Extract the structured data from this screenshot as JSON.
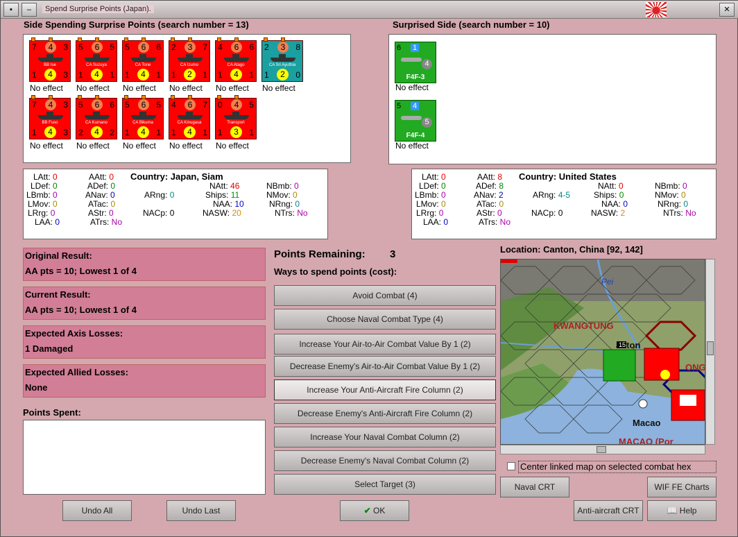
{
  "window": {
    "title": "Spend Surprise Points (Japan)."
  },
  "left": {
    "header": "Side Spending Surprise Points (search number = 13)"
  },
  "right": {
    "header": "Surprised Side (search number = 10)"
  },
  "attackers": [
    {
      "name": "BB Ise",
      "tl": "7",
      "top": "4",
      "tr": "3",
      "bl": "1",
      "bot": "4",
      "br": "3",
      "color": "#ff0000",
      "effect": "No effect"
    },
    {
      "name": "CA Suzuya",
      "tl": "5",
      "top": "6",
      "tr": "5",
      "bl": "1",
      "bot": "4",
      "br": "1",
      "color": "#ff0000",
      "effect": "No effect"
    },
    {
      "name": "CA Tone",
      "tl": "5",
      "top": "6",
      "tr": "6",
      "bl": "1",
      "bot": "4",
      "br": "1",
      "color": "#ff0000",
      "effect": "No effect"
    },
    {
      "name": "CA Izumo",
      "tl": "2",
      "top": "3",
      "tr": "7",
      "bl": "1",
      "bot": "2",
      "br": "1",
      "color": "#ff0000",
      "effect": "No effect"
    },
    {
      "name": "CA Atago",
      "tl": "4",
      "top": "6",
      "tr": "6",
      "bl": "1",
      "bot": "4",
      "br": "1",
      "color": "#ff0000",
      "effect": "No effect"
    },
    {
      "name": "CA Sri Ayuthia",
      "sub": "SIA",
      "tl": "2",
      "top": "3",
      "tr": "8",
      "bl": "1",
      "bot": "2",
      "br": "0",
      "color": "#1aa0a0",
      "effect": "No effect"
    },
    {
      "name": "BB Fuso",
      "tl": "7",
      "top": "4",
      "tr": "3",
      "bl": "1",
      "bot": "4",
      "br": "3",
      "color": "#ff0000",
      "effect": "No effect"
    },
    {
      "name": "CA Kumano",
      "tl": "5",
      "top": "6",
      "tr": "6",
      "bl": "2",
      "bot": "4",
      "br": "2",
      "color": "#ff0000",
      "effect": "No effect"
    },
    {
      "name": "CA Bikuma",
      "tl": "5",
      "top": "6",
      "tr": "5",
      "bl": "1",
      "bot": "4",
      "br": "1",
      "color": "#ff0000",
      "effect": "No effect"
    },
    {
      "name": "CA Kinugasa",
      "tl": "4",
      "top": "6",
      "tr": "7",
      "bl": "1",
      "bot": "4",
      "br": "1",
      "color": "#ff0000",
      "effect": "No effect"
    },
    {
      "name": "Transport",
      "tl": "0",
      "top": "4",
      "tr": "5",
      "bl": "1",
      "bot": "3",
      "br": "1",
      "color": "#ff0000",
      "effect": "No effect"
    }
  ],
  "defenders": [
    {
      "name": "F4F-3",
      "tag": "1",
      "val": "4",
      "tl": "6",
      "effect": "No effect"
    },
    {
      "name": "F4F-4",
      "tag": "4",
      "val": "5",
      "tl": "5",
      "effect": "No effect"
    }
  ],
  "stats_left": {
    "country_label": "Country:",
    "country": "Japan, Siam",
    "LAtt": "0",
    "LDef": "0",
    "LBmb": "0",
    "LMov": "0",
    "LRrg": "0",
    "LAA": "0",
    "AAtt": "0",
    "ADef": "0",
    "ANav": "0",
    "ATac": "0",
    "AStr": "0",
    "ATrs": "No",
    "ARng": "0",
    "NACp": "0",
    "NAtt": "46",
    "Ships": "11",
    "NAA": "10",
    "NASW": "20",
    "NBmb": "0",
    "NMov": "0",
    "NRng": "0",
    "NTrs": "No"
  },
  "stats_right": {
    "country_label": "Country:",
    "country": "United States",
    "LAtt": "0",
    "LDef": "0",
    "LBmb": "0",
    "LMov": "0",
    "LRrg": "0",
    "LAA": "0",
    "AAtt": "8",
    "ADef": "8",
    "ANav": "2",
    "ATac": "0",
    "AStr": "0",
    "ATrs": "No",
    "ARng": "4-5",
    "NACp": "0",
    "NAtt": "0",
    "Ships": "0",
    "NAA": "0",
    "NASW": "2",
    "NBmb": "0",
    "NMov": "0",
    "NRng": "0",
    "NTrs": "No"
  },
  "results": {
    "original_label": "Original Result:",
    "original": "AA pts = 10; Lowest 1 of 4",
    "current_label": "Current Result:",
    "current": "AA pts = 10; Lowest 1 of 4",
    "axis_label": "Expected Axis Losses:",
    "axis": "1 Damaged",
    "allied_label": "Expected Allied Losses:",
    "allied": "None",
    "spent_label": "Points Spent:"
  },
  "points": {
    "label": "Points Remaining:",
    "value": "3",
    "ways": "Ways to spend points (cost):"
  },
  "options": [
    "Avoid Combat (4)",
    "Choose Naval Combat Type (4)",
    "Increase Your Air-to-Air Combat Value By 1 (2)",
    "Decrease Enemy's Air-to-Air Combat Value By 1 (2)",
    "Increase Your Anti-Aircraft Fire Column (2)",
    "Decrease Enemy's Anti-Aircraft Fire Column (2)",
    "Increase Your Naval Combat Column (2)",
    "Decrease Enemy's Naval Combat Column (2)",
    "Select Target (3)"
  ],
  "location": {
    "label": "Location: Canton, China [92, 142]"
  },
  "map": {
    "pei": "Pei",
    "kwangtung": "KWANGTUNG",
    "canton": "anton",
    "macao": "Macao",
    "macao_port": "MACAO (Por",
    "onc": "ONG",
    "num15": "15"
  },
  "center_linked": "Center linked map on selected combat hex",
  "buttons": {
    "undo_all": "Undo All",
    "undo_last": "Undo Last",
    "ok": "OK",
    "naval_crt": "Naval CRT",
    "wif_fe": "WIF FE Charts",
    "aa_crt": "Anti-aircraft CRT",
    "help": "Help"
  }
}
